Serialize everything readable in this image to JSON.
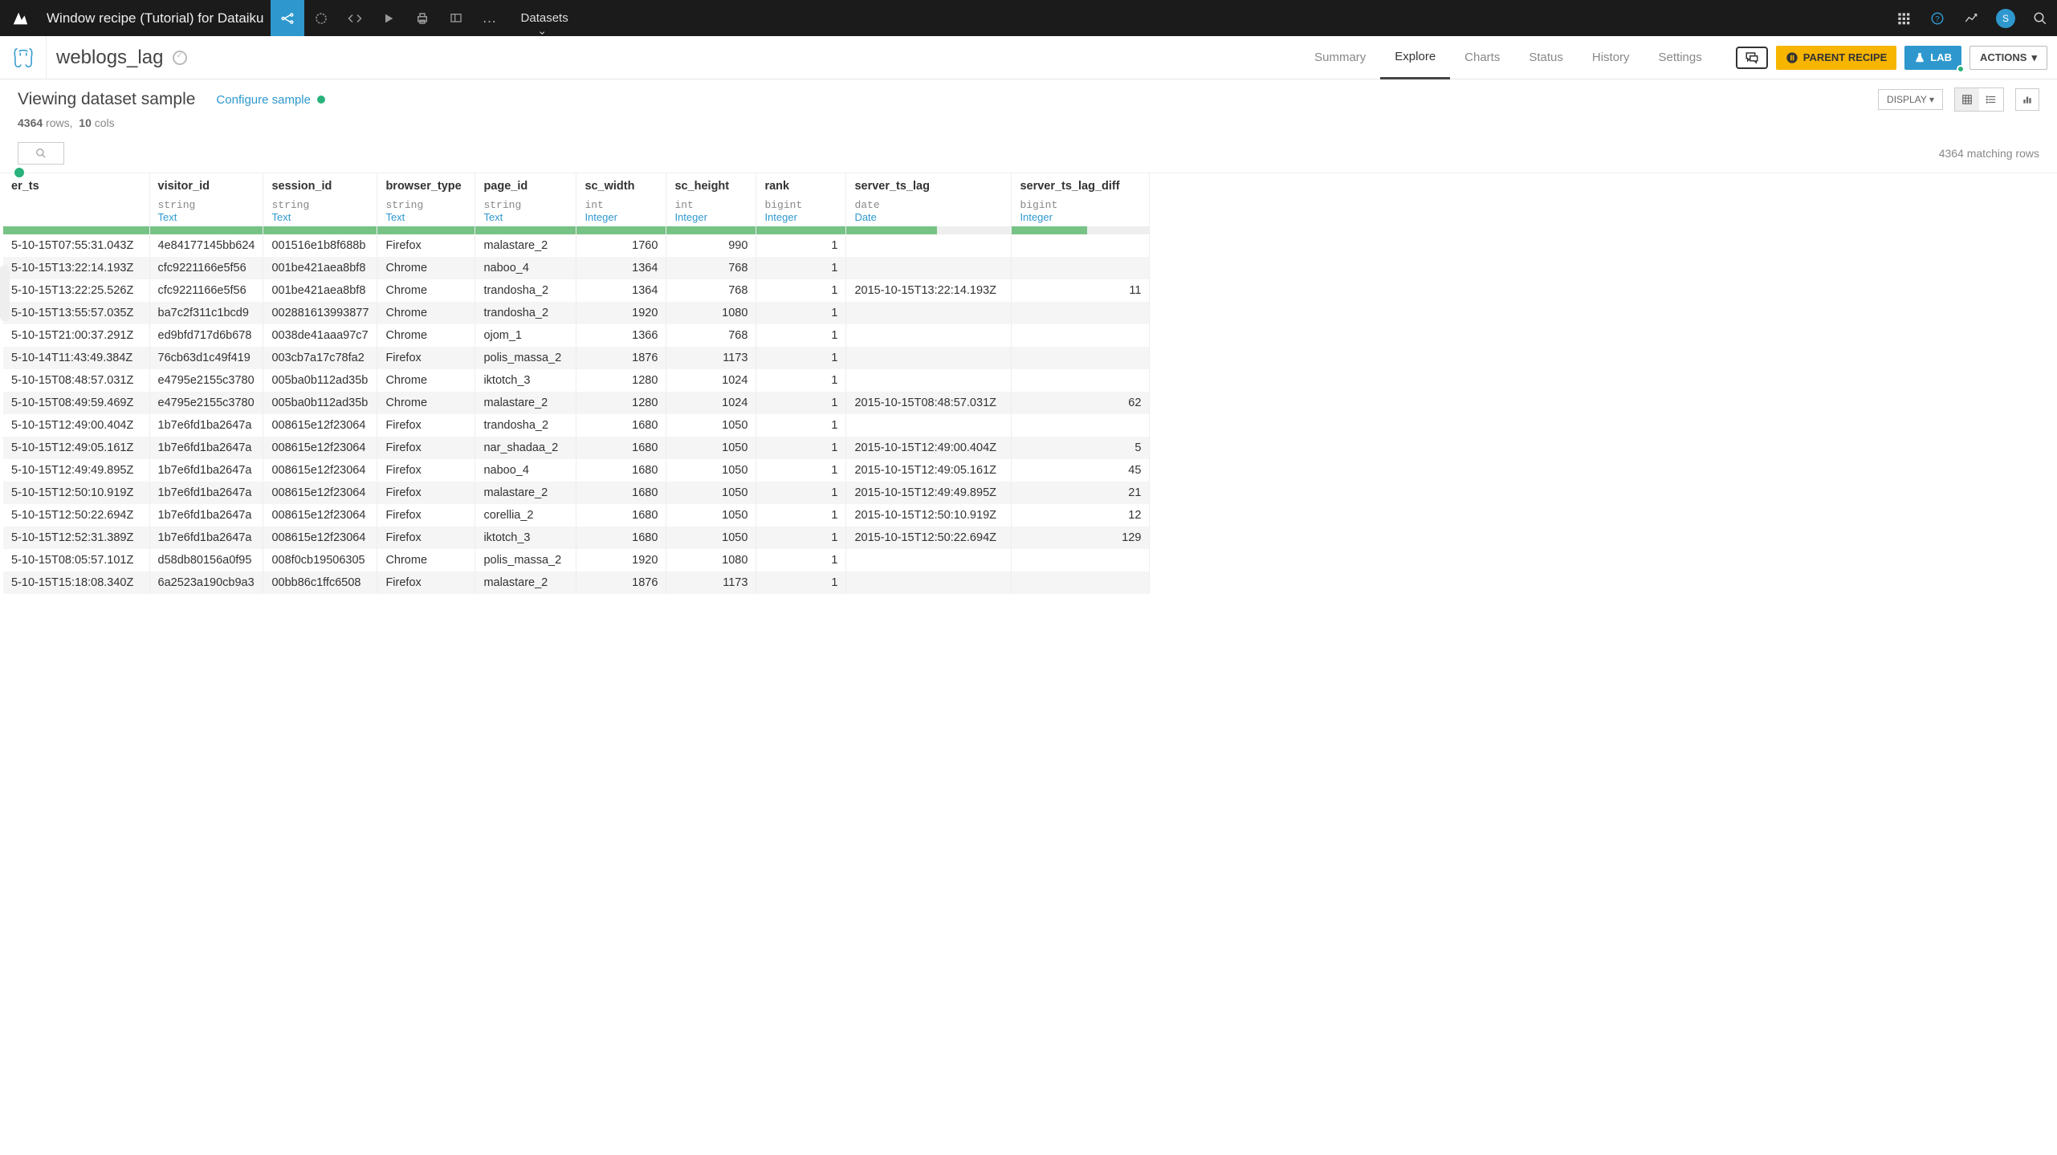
{
  "topbar": {
    "title": "Window recipe (Tutorial) for Dataiku",
    "datasets_label": "Datasets",
    "avatar_initial": "S"
  },
  "subbar": {
    "dataset_name": "weblogs_lag",
    "tabs": [
      "Summary",
      "Explore",
      "Charts",
      "Status",
      "History",
      "Settings"
    ],
    "active_tab": 1,
    "parent_recipe": "PARENT RECIPE",
    "lab": "LAB",
    "actions": "ACTIONS"
  },
  "toolbar": {
    "view_title": "Viewing dataset sample",
    "configure": "Configure sample",
    "display": "DISPLAY",
    "rows": "4364",
    "rows_label": "rows,",
    "cols": "10",
    "cols_label": "cols",
    "matching": "4364 matching rows"
  },
  "columns": [
    {
      "name": "er_ts",
      "type": "",
      "sem": "",
      "fill": 100,
      "align": "left"
    },
    {
      "name": "visitor_id",
      "type": "string",
      "sem": "Text",
      "fill": 100,
      "align": "left"
    },
    {
      "name": "session_id",
      "type": "string",
      "sem": "Text",
      "fill": 100,
      "align": "left"
    },
    {
      "name": "browser_type",
      "type": "string",
      "sem": "Text",
      "fill": 100,
      "align": "left"
    },
    {
      "name": "page_id",
      "type": "string",
      "sem": "Text",
      "fill": 100,
      "align": "left"
    },
    {
      "name": "sc_width",
      "type": "int",
      "sem": "Integer",
      "fill": 100,
      "align": "right"
    },
    {
      "name": "sc_height",
      "type": "int",
      "sem": "Integer",
      "fill": 100,
      "align": "right"
    },
    {
      "name": "rank",
      "type": "bigint",
      "sem": "Integer",
      "fill": 100,
      "align": "right"
    },
    {
      "name": "server_ts_lag",
      "type": "date",
      "sem": "Date",
      "fill": 55,
      "align": "left"
    },
    {
      "name": "server_ts_lag_diff",
      "type": "bigint",
      "sem": "Integer",
      "fill": 55,
      "align": "right"
    }
  ],
  "rows": [
    [
      "5-10-15T07:55:31.043Z",
      "4e84177145bb624",
      "001516e1b8f688b",
      "Firefox",
      "malastare_2",
      "1760",
      "990",
      "1",
      "",
      ""
    ],
    [
      "5-10-15T13:22:14.193Z",
      "cfc9221166e5f56",
      "001be421aea8bf8",
      "Chrome",
      "naboo_4",
      "1364",
      "768",
      "1",
      "",
      ""
    ],
    [
      "5-10-15T13:22:25.526Z",
      "cfc9221166e5f56",
      "001be421aea8bf8",
      "Chrome",
      "trandosha_2",
      "1364",
      "768",
      "1",
      "2015-10-15T13:22:14.193Z",
      "11"
    ],
    [
      "5-10-15T13:55:57.035Z",
      "ba7c2f311c1bcd9",
      "002881613993877",
      "Chrome",
      "trandosha_2",
      "1920",
      "1080",
      "1",
      "",
      ""
    ],
    [
      "5-10-15T21:00:37.291Z",
      "ed9bfd717d6b678",
      "0038de41aaa97c7",
      "Chrome",
      "ojom_1",
      "1366",
      "768",
      "1",
      "",
      ""
    ],
    [
      "5-10-14T11:43:49.384Z",
      "76cb63d1c49f419",
      "003cb7a17c78fa2",
      "Firefox",
      "polis_massa_2",
      "1876",
      "1173",
      "1",
      "",
      ""
    ],
    [
      "5-10-15T08:48:57.031Z",
      "e4795e2155c3780",
      "005ba0b112ad35b",
      "Chrome",
      "iktotch_3",
      "1280",
      "1024",
      "1",
      "",
      ""
    ],
    [
      "5-10-15T08:49:59.469Z",
      "e4795e2155c3780",
      "005ba0b112ad35b",
      "Chrome",
      "malastare_2",
      "1280",
      "1024",
      "1",
      "2015-10-15T08:48:57.031Z",
      "62"
    ],
    [
      "5-10-15T12:49:00.404Z",
      "1b7e6fd1ba2647a",
      "008615e12f23064",
      "Firefox",
      "trandosha_2",
      "1680",
      "1050",
      "1",
      "",
      ""
    ],
    [
      "5-10-15T12:49:05.161Z",
      "1b7e6fd1ba2647a",
      "008615e12f23064",
      "Firefox",
      "nar_shadaa_2",
      "1680",
      "1050",
      "1",
      "2015-10-15T12:49:00.404Z",
      "5"
    ],
    [
      "5-10-15T12:49:49.895Z",
      "1b7e6fd1ba2647a",
      "008615e12f23064",
      "Firefox",
      "naboo_4",
      "1680",
      "1050",
      "1",
      "2015-10-15T12:49:05.161Z",
      "45"
    ],
    [
      "5-10-15T12:50:10.919Z",
      "1b7e6fd1ba2647a",
      "008615e12f23064",
      "Firefox",
      "malastare_2",
      "1680",
      "1050",
      "1",
      "2015-10-15T12:49:49.895Z",
      "21"
    ],
    [
      "5-10-15T12:50:22.694Z",
      "1b7e6fd1ba2647a",
      "008615e12f23064",
      "Firefox",
      "corellia_2",
      "1680",
      "1050",
      "1",
      "2015-10-15T12:50:10.919Z",
      "12"
    ],
    [
      "5-10-15T12:52:31.389Z",
      "1b7e6fd1ba2647a",
      "008615e12f23064",
      "Firefox",
      "iktotch_3",
      "1680",
      "1050",
      "1",
      "2015-10-15T12:50:22.694Z",
      "129"
    ],
    [
      "5-10-15T08:05:57.101Z",
      "d58db80156a0f95",
      "008f0cb19506305",
      "Chrome",
      "polis_massa_2",
      "1920",
      "1080",
      "1",
      "",
      ""
    ],
    [
      "5-10-15T15:18:08.340Z",
      "6a2523a190cb9a3",
      "00bb86c1ffc6508",
      "Firefox",
      "malastare_2",
      "1876",
      "1173",
      "1",
      "",
      ""
    ]
  ]
}
